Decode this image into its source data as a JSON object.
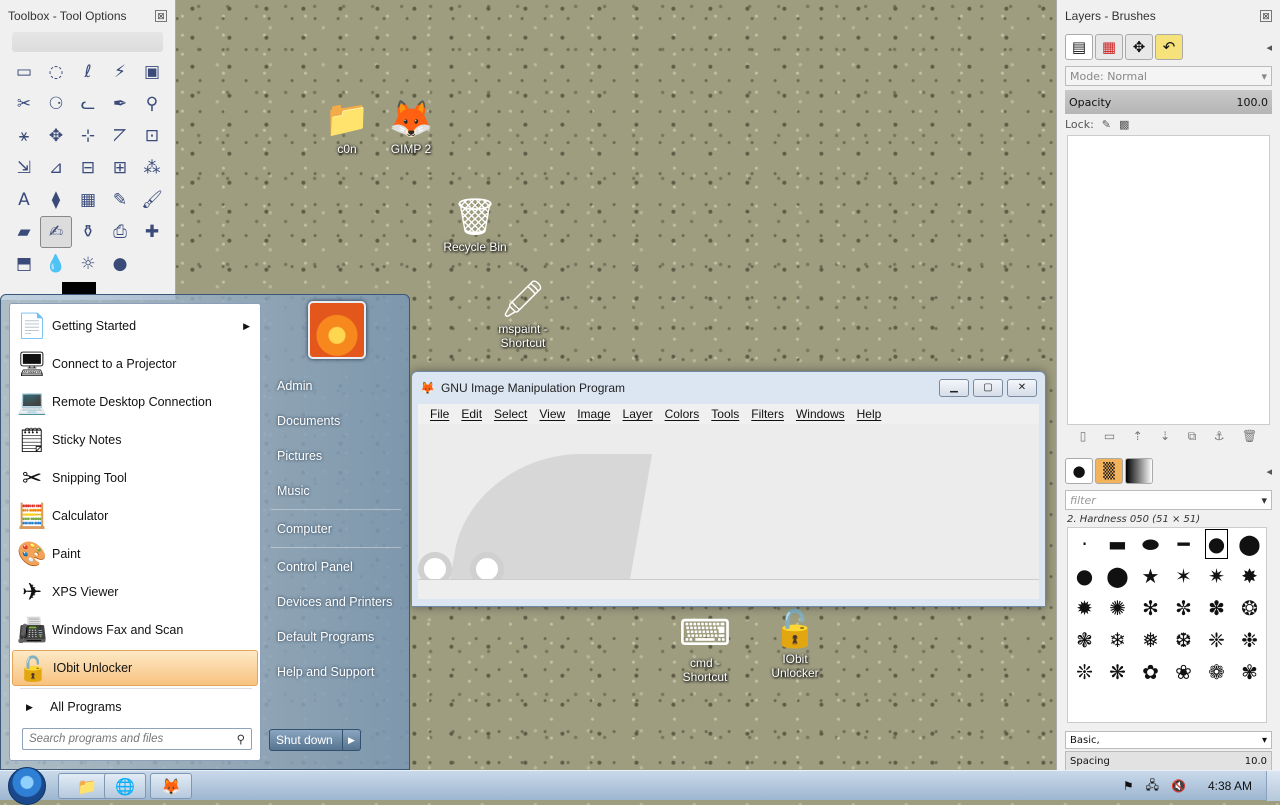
{
  "toolbox": {
    "title": "Toolbox - Tool Options",
    "close": "⊠",
    "tools": [
      "▭",
      "◌",
      "ℓ",
      "⚡",
      "▣",
      "✂",
      "⚆",
      "ᓚ",
      "✒",
      "⚲",
      "⚹",
      "✥",
      "⊹",
      "⦢",
      "⊡",
      "⇲",
      "⊿",
      "⊟",
      "⊞",
      "⁂",
      "A",
      "⧫",
      "▦",
      "✎",
      "🖌",
      "▰",
      "✍",
      "⚱",
      "⎙",
      "✚",
      "⬒",
      "💧",
      "☼",
      "●"
    ]
  },
  "desktop_icons": [
    {
      "name": "c0n",
      "glyph": "📁"
    },
    {
      "name": "GIMP 2",
      "glyph": "🦊"
    },
    {
      "name": "Recycle Bin",
      "glyph": "🗑"
    },
    {
      "name": "mspaint - Shortcut",
      "glyph": "🖍"
    },
    {
      "name": "cmd - Shortcut",
      "glyph": "⌨"
    },
    {
      "name": "IObit Unlocker",
      "glyph": "🔓"
    }
  ],
  "gimp_window": {
    "title": "GNU Image Manipulation Program",
    "menus": [
      "File",
      "Edit",
      "Select",
      "View",
      "Image",
      "Layer",
      "Colors",
      "Tools",
      "Filters",
      "Windows",
      "Help"
    ]
  },
  "layers": {
    "title": "Layers - Brushes",
    "mode_label": "Mode:",
    "mode_value": "Normal",
    "opacity_label": "Opacity",
    "opacity_value": "100.0",
    "lock_label": "Lock:",
    "brush_filter": "filter",
    "brush_name": "2. Hardness 050 (51 × 51)",
    "preset": "Basic,",
    "spacing_label": "Spacing",
    "spacing_value": "10.0",
    "brushes": [
      "·",
      "▬",
      "⬬",
      "━",
      "●",
      "⬤",
      "●",
      "⬤",
      "★",
      "✶",
      "✷",
      "✸",
      "✹",
      "✺",
      "✻",
      "✼",
      "✽",
      "❂",
      "❃",
      "❄",
      "❅",
      "❆",
      "❈",
      "❉",
      "❊",
      "❋",
      "✿",
      "❀",
      "❁",
      "✾"
    ]
  },
  "start_menu": {
    "left_items": [
      {
        "label": "Getting Started",
        "icon": "📄",
        "submenu": true
      },
      {
        "label": "Connect to a Projector",
        "icon": "🖥"
      },
      {
        "label": "Remote Desktop Connection",
        "icon": "💻"
      },
      {
        "label": "Sticky Notes",
        "icon": "🗒"
      },
      {
        "label": "Snipping Tool",
        "icon": "✂"
      },
      {
        "label": "Calculator",
        "icon": "🧮"
      },
      {
        "label": "Paint",
        "icon": "🎨"
      },
      {
        "label": "XPS Viewer",
        "icon": "✈"
      },
      {
        "label": "Windows Fax and Scan",
        "icon": "📠"
      },
      {
        "label": "IObit Unlocker",
        "icon": "🔓",
        "highlighted": true
      }
    ],
    "all_programs": "All Programs",
    "search_placeholder": "Search programs and files",
    "right_items": [
      "Admin",
      "Documents",
      "Pictures",
      "Music",
      "Computer",
      "Control Panel",
      "Devices and Printers",
      "Default Programs",
      "Help and Support"
    ],
    "shutdown": "Shut down"
  },
  "taskbar": {
    "buttons": [
      "📁",
      "🌐",
      "🦊"
    ],
    "clock": "4:38 AM"
  }
}
